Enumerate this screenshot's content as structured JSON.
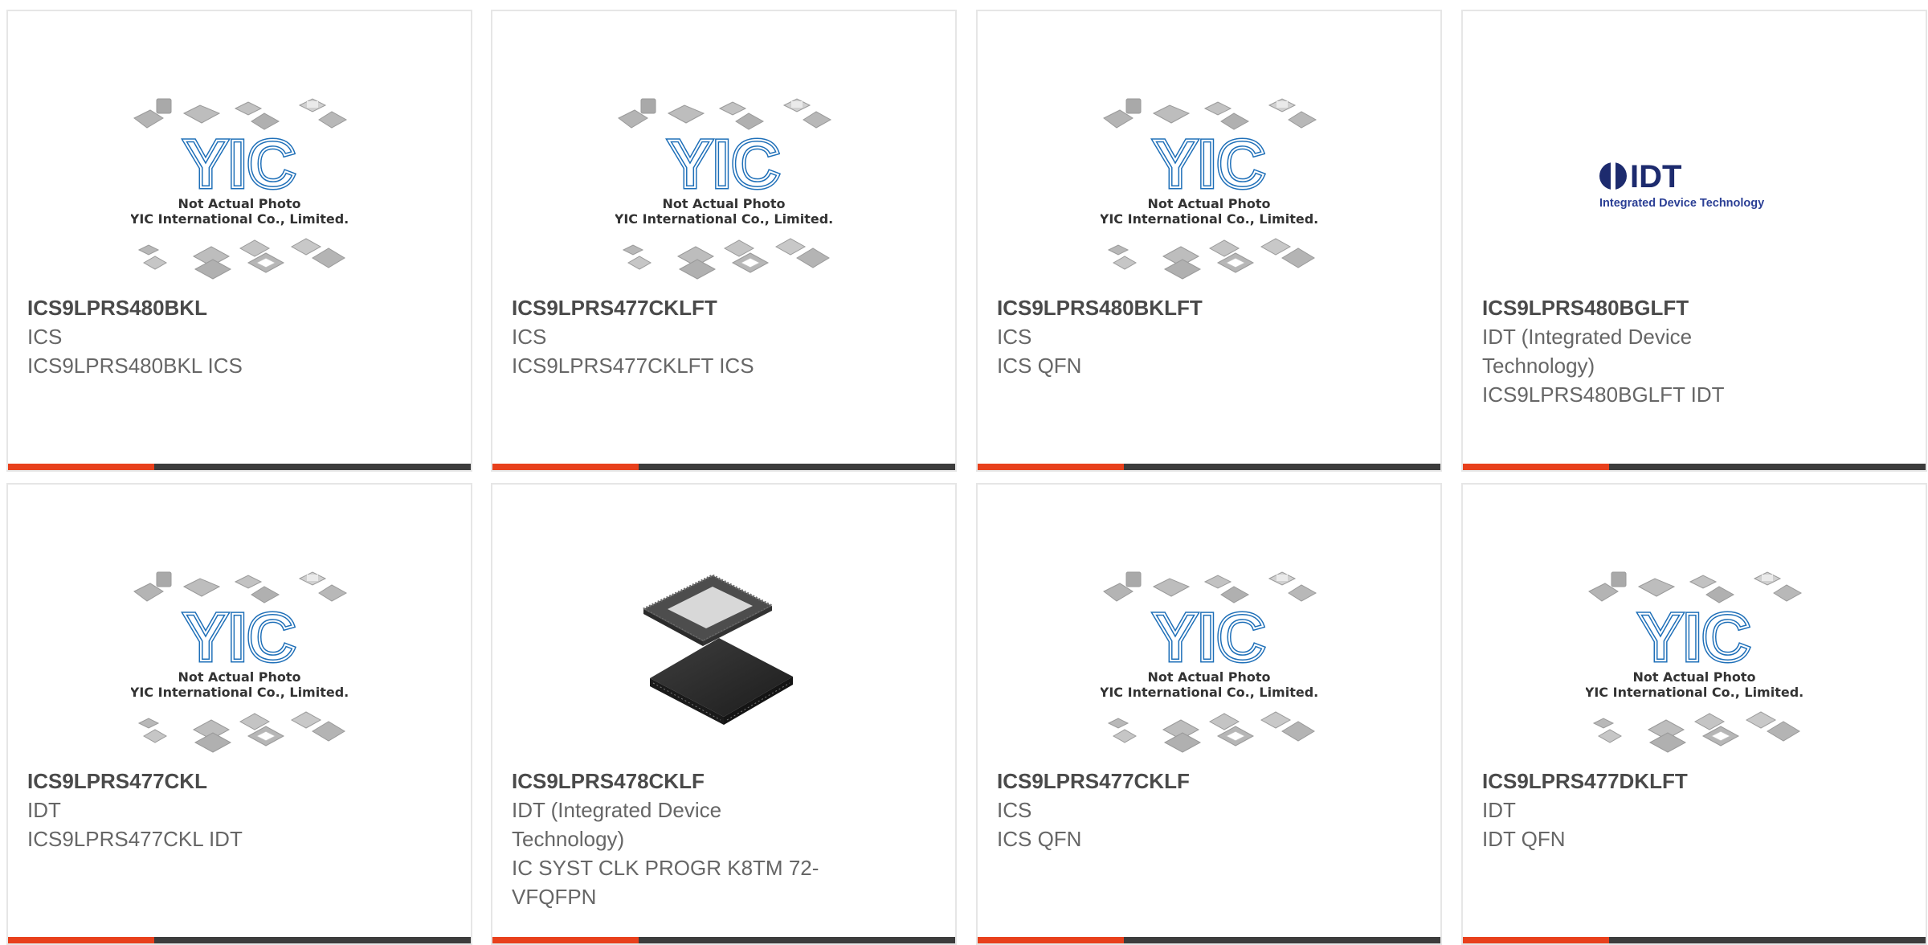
{
  "colors": {
    "accent": "#e8401c",
    "bar": "#3c3c3c",
    "border": "#e6e6e6",
    "title": "#4a4a4a",
    "text": "#666666",
    "yic_blue": "#1e6fb8",
    "idt_navy": "#1d2b6e"
  },
  "placeholder": {
    "logo_text": "YIC",
    "line1": "Not Actual Photo",
    "line2": "YIC International Co., Limited."
  },
  "idt_logo": {
    "mark": "IDT",
    "tagline": "Integrated Device Technology"
  },
  "products": [
    {
      "image": "placeholder",
      "part_number": "ICS9LPRS480BKL",
      "lines": [
        "ICS",
        "ICS9LPRS480BKL ICS"
      ]
    },
    {
      "image": "placeholder",
      "part_number": "ICS9LPRS477CKLFT",
      "lines": [
        "ICS",
        "ICS9LPRS477CKLFT ICS"
      ]
    },
    {
      "image": "placeholder",
      "part_number": "ICS9LPRS480BKLFT",
      "lines": [
        "ICS",
        "ICS QFN"
      ]
    },
    {
      "image": "idt-logo",
      "part_number": "ICS9LPRS480BGLFT",
      "lines": [
        "IDT (Integrated Device",
        "Technology)",
        "ICS9LPRS480BGLFT IDT"
      ]
    },
    {
      "image": "placeholder",
      "part_number": "ICS9LPRS477CKL",
      "lines": [
        "IDT",
        "ICS9LPRS477CKL IDT"
      ]
    },
    {
      "image": "chip-photo",
      "part_number": "ICS9LPRS478CKLF",
      "lines": [
        "IDT (Integrated Device",
        "Technology)",
        "IC SYST CLK PROGR K8TM 72-",
        "VFQFPN"
      ]
    },
    {
      "image": "placeholder",
      "part_number": "ICS9LPRS477CKLF",
      "lines": [
        "ICS",
        "ICS QFN"
      ]
    },
    {
      "image": "placeholder",
      "part_number": "ICS9LPRS477DKLFT",
      "lines": [
        "IDT",
        "IDT QFN"
      ]
    }
  ]
}
